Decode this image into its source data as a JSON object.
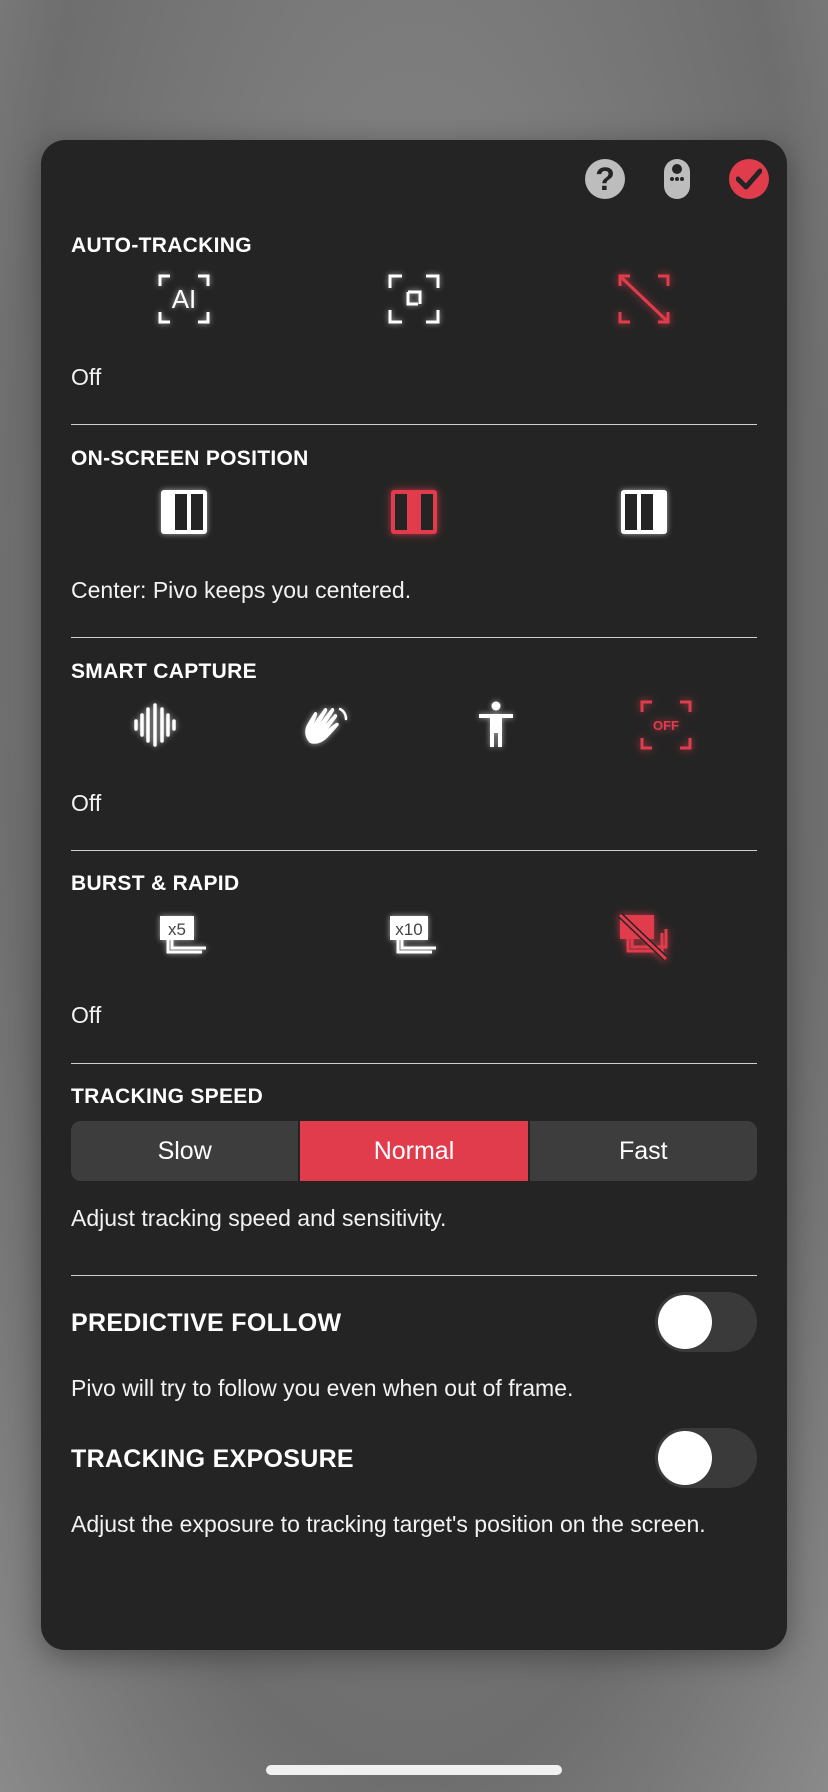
{
  "colors": {
    "accent": "#e03c4c",
    "panel": "#252424",
    "text": "#ffffff"
  },
  "header": {
    "help_icon": "question-circle-icon",
    "remote_icon": "remote-control-icon",
    "confirm_icon": "checkmark-circle-icon",
    "help_glyph": "?"
  },
  "auto_tracking": {
    "title": "AUTO-TRACKING",
    "options": [
      {
        "icon": "ai-frame-icon",
        "label": "AI",
        "selected": false
      },
      {
        "icon": "focus-frame-icon",
        "selected": false
      },
      {
        "icon": "frame-off-icon",
        "selected": true
      }
    ],
    "status": "Off"
  },
  "on_screen_position": {
    "title": "ON-SCREEN POSITION",
    "options": [
      {
        "icon": "position-left-icon",
        "selected": false
      },
      {
        "icon": "position-center-icon",
        "selected": true
      },
      {
        "icon": "position-right-icon",
        "selected": false
      }
    ],
    "status": "Center: Pivo keeps you centered."
  },
  "smart_capture": {
    "title": "SMART CAPTURE",
    "options": [
      {
        "icon": "voice-waveform-icon",
        "selected": false
      },
      {
        "icon": "hand-wave-icon",
        "selected": false
      },
      {
        "icon": "body-pose-icon",
        "selected": false
      },
      {
        "icon": "capture-off-icon",
        "label": "OFF",
        "selected": true
      }
    ],
    "status": "Off"
  },
  "burst_rapid": {
    "title": "BURST & RAPID",
    "options": [
      {
        "icon": "burst-x5-icon",
        "label": "x5",
        "selected": false
      },
      {
        "icon": "burst-x10-icon",
        "label": "x10",
        "selected": false
      },
      {
        "icon": "burst-off-icon",
        "selected": true
      }
    ],
    "status": "Off"
  },
  "tracking_speed": {
    "title": "TRACKING SPEED",
    "options": [
      "Slow",
      "Normal",
      "Fast"
    ],
    "selected": "Normal",
    "status": "Adjust tracking speed and sensitivity."
  },
  "predictive_follow": {
    "title": "PREDICTIVE FOLLOW",
    "enabled": false,
    "description": "Pivo will try to follow you even when out of frame."
  },
  "tracking_exposure": {
    "title": "TRACKING EXPOSURE",
    "enabled": false,
    "description": "Adjust the exposure to tracking target's position on the screen."
  }
}
